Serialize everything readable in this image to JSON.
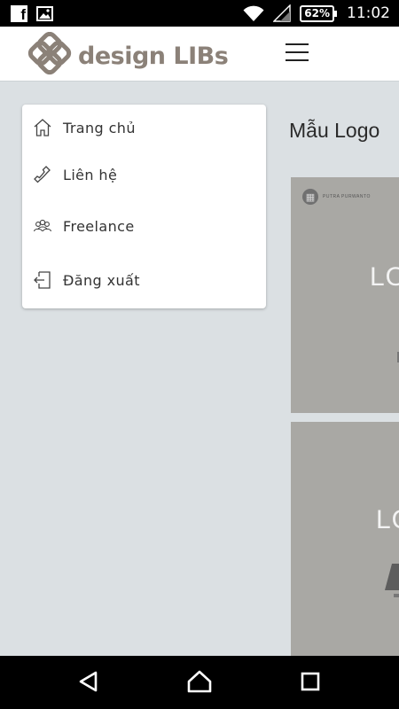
{
  "status_bar": {
    "battery": "62%",
    "time": "11:02",
    "icons": [
      "facebook-icon",
      "image-icon",
      "wifi-icon",
      "signal-icon",
      "battery-icon"
    ]
  },
  "header": {
    "logo_text": "design LIBs",
    "menu_icon": "hamburger-icon"
  },
  "menu": {
    "items": [
      {
        "label": "Trang chủ",
        "icon": "home-icon"
      },
      {
        "label": "Liên hệ",
        "icon": "phone-icon"
      },
      {
        "label": "Freelance",
        "icon": "people-icon"
      },
      {
        "label": "Đăng xuất",
        "icon": "logout-icon"
      }
    ]
  },
  "content": {
    "section_title": "Mẫu Logo",
    "cards": [
      {
        "brand": "PUTRA PURWANTO",
        "text": "LO"
      },
      {
        "text": "LO"
      }
    ]
  },
  "nav_bar": {
    "buttons": [
      "back-icon",
      "home-icon",
      "recent-apps-icon"
    ]
  },
  "colors": {
    "background": "#dbe0e3",
    "header": "#ffffff",
    "logo": "#8b8178",
    "card": "#a9a8a4",
    "status_bar": "#000000"
  }
}
